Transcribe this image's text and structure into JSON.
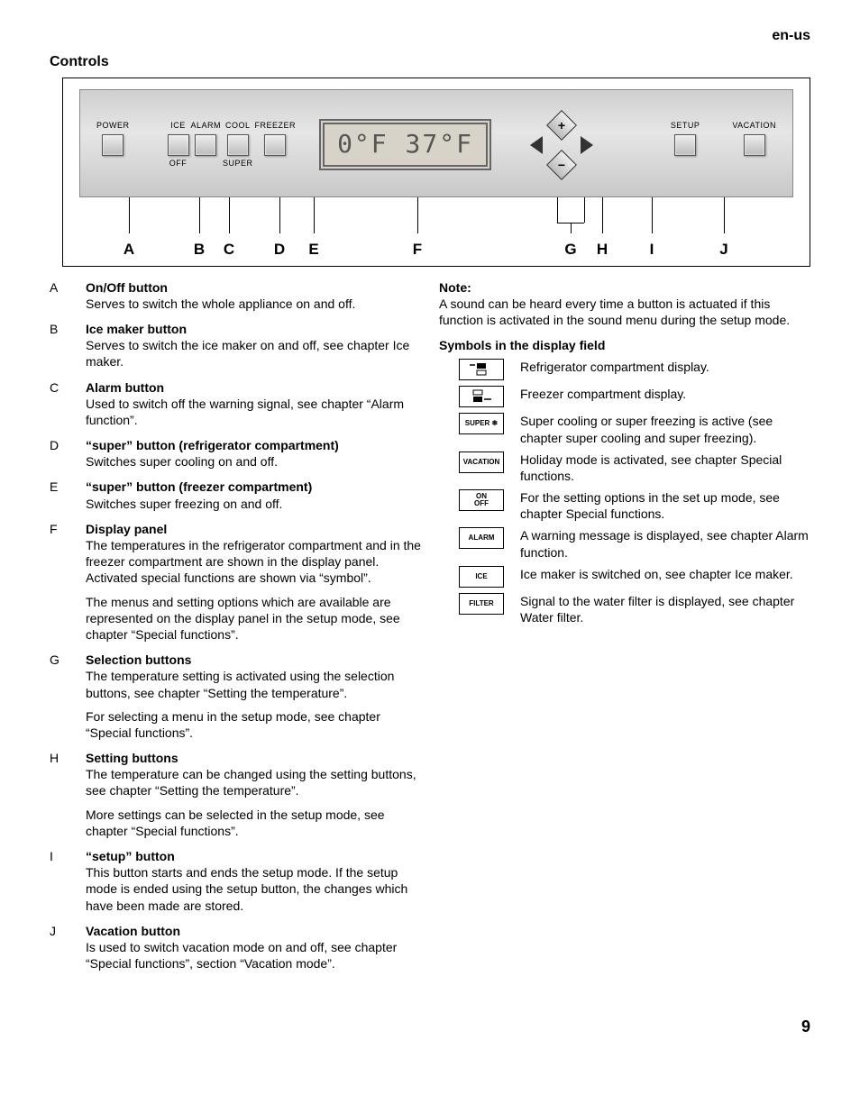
{
  "locale": "en-us",
  "heading": "Controls",
  "panel": {
    "buttons": [
      {
        "top": "POWER",
        "bot": ""
      },
      {
        "top": "ICE",
        "bot": "OFF"
      },
      {
        "top": "ALARM",
        "bot": ""
      },
      {
        "top": "COOL",
        "bot": "SUPER"
      },
      {
        "top": "FREEZER",
        "bot": ""
      }
    ],
    "display_text": "0°F  37°F",
    "right_buttons": [
      {
        "top": "SETUP",
        "bot": ""
      },
      {
        "top": "VACATION",
        "bot": ""
      }
    ],
    "letters": [
      "A",
      "B",
      "C",
      "D",
      "E",
      "F",
      "G",
      "H",
      "I",
      "J"
    ]
  },
  "items": [
    {
      "l": "A",
      "t": "On/Off button",
      "d": [
        "Serves to switch the whole appliance on and off."
      ]
    },
    {
      "l": "B",
      "t": "Ice maker button",
      "d": [
        "Serves to switch the ice maker on and off, see chapter Ice maker."
      ]
    },
    {
      "l": "C",
      "t": "Alarm button",
      "d": [
        "Used to switch off the warning signal, see chapter “Alarm function”."
      ]
    },
    {
      "l": "D",
      "t": "“super” button (refrigerator compartment)",
      "d": [
        "Switches super cooling on and off."
      ]
    },
    {
      "l": "E",
      "t": "“super” button (freezer compartment)",
      "d": [
        "Switches super freezing on and off."
      ]
    },
    {
      "l": "F",
      "t": "Display panel",
      "d": [
        "The temperatures in the refrigerator compartment and in the freezer compartment are shown in the display panel. Activated special functions are shown via “symbol”.",
        "The menus and setting options which are available are represented on the display panel in the setup mode, see chapter “Special functions”."
      ]
    },
    {
      "l": "G",
      "t": "Selection buttons",
      "d": [
        "The temperature setting is activated using the selection buttons, see chapter “Setting the temperature”.",
        "For selecting a menu in the setup mode, see chapter “Special functions”."
      ]
    },
    {
      "l": "H",
      "t": "Setting buttons",
      "d": [
        "The temperature can be changed using the setting buttons, see chapter “Setting the temperature”.",
        "More settings can be selected in the setup mode, see chapter “Special functions”."
      ]
    },
    {
      "l": "I",
      "t": "“setup” button",
      "d": [
        "This button starts and ends the setup mode. If the setup mode is ended using the setup button, the changes which have been made are stored."
      ]
    },
    {
      "l": "J",
      "t": "Vacation button",
      "d": [
        "Is used to switch vacation mode on and off, see chapter “Special functions”, section “Vacation mode”."
      ]
    }
  ],
  "note_title": "Note:",
  "note_text": "A sound can be heard every time a button is actuated if this function is activated in the sound menu during the setup mode.",
  "symbols_title": "Symbols in the display field",
  "symbols": [
    {
      "icon": "fridge",
      "text": "Refrigerator compartment display."
    },
    {
      "icon": "freezer",
      "text": "Freezer compartment display."
    },
    {
      "icon": "SUPER ❄",
      "text": "Super cooling or super freezing is active (see chapter super cooling and super freezing)."
    },
    {
      "icon": "VACATION",
      "text": "Holiday mode is activated, see chapter Special functions."
    },
    {
      "icon": "ON\nOFF",
      "text": "For the setting options in the set up mode, see chapter Special functions."
    },
    {
      "icon": "ALARM",
      "text": "A warning message is displayed, see chapter Alarm function."
    },
    {
      "icon": "ICE",
      "text": "Ice maker is switched on, see chapter Ice maker."
    },
    {
      "icon": "FILTER",
      "text": "Signal to the water filter is displayed, see chapter Water filter."
    }
  ],
  "page": "9"
}
